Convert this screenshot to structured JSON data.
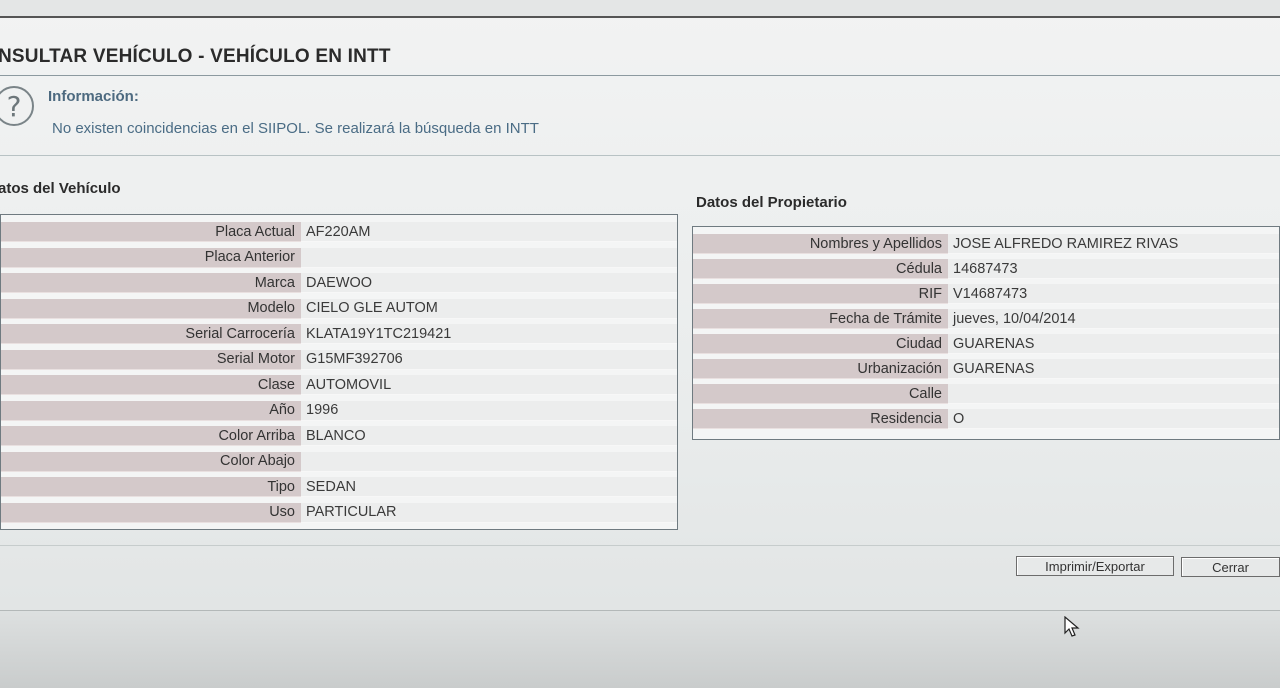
{
  "page": {
    "title": "NSULTAR VEHÍCULO - VEHÍCULO EN INTT"
  },
  "info": {
    "heading": "Información:",
    "message": "No existen coincidencias en el SIIPOL. Se realizará la búsqueda en INTT",
    "icon": "question-icon"
  },
  "vehicle": {
    "section_title": "atos del Vehículo",
    "rows": [
      {
        "label": "Placa Actual",
        "value": "AF220AM"
      },
      {
        "label": "Placa Anterior",
        "value": ""
      },
      {
        "label": "Marca",
        "value": "DAEWOO"
      },
      {
        "label": "Modelo",
        "value": "CIELO GLE AUTOM"
      },
      {
        "label": "Serial Carrocería",
        "value": "KLATA19Y1TC219421"
      },
      {
        "label": "Serial Motor",
        "value": "G15MF392706"
      },
      {
        "label": "Clase",
        "value": "AUTOMOVIL"
      },
      {
        "label": "Año",
        "value": "1996"
      },
      {
        "label": "Color Arriba",
        "value": "BLANCO"
      },
      {
        "label": "Color Abajo",
        "value": ""
      },
      {
        "label": "Tipo",
        "value": "SEDAN"
      },
      {
        "label": "Uso",
        "value": "PARTICULAR"
      }
    ]
  },
  "owner": {
    "section_title": "Datos del Propietario",
    "rows": [
      {
        "label": "Nombres y Apellidos",
        "value": "JOSE ALFREDO RAMIREZ RIVAS"
      },
      {
        "label": "Cédula",
        "value": "14687473"
      },
      {
        "label": "RIF",
        "value": "V14687473"
      },
      {
        "label": "Fecha de Trámite",
        "value": "jueves, 10/04/2014"
      },
      {
        "label": "Ciudad",
        "value": "GUARENAS"
      },
      {
        "label": "Urbanización",
        "value": "GUARENAS"
      },
      {
        "label": "Calle",
        "value": ""
      },
      {
        "label": "Residencia",
        "value": "O"
      }
    ]
  },
  "buttons": {
    "print_label": "Imprimir/Exportar",
    "close_label": "Cerrar"
  }
}
